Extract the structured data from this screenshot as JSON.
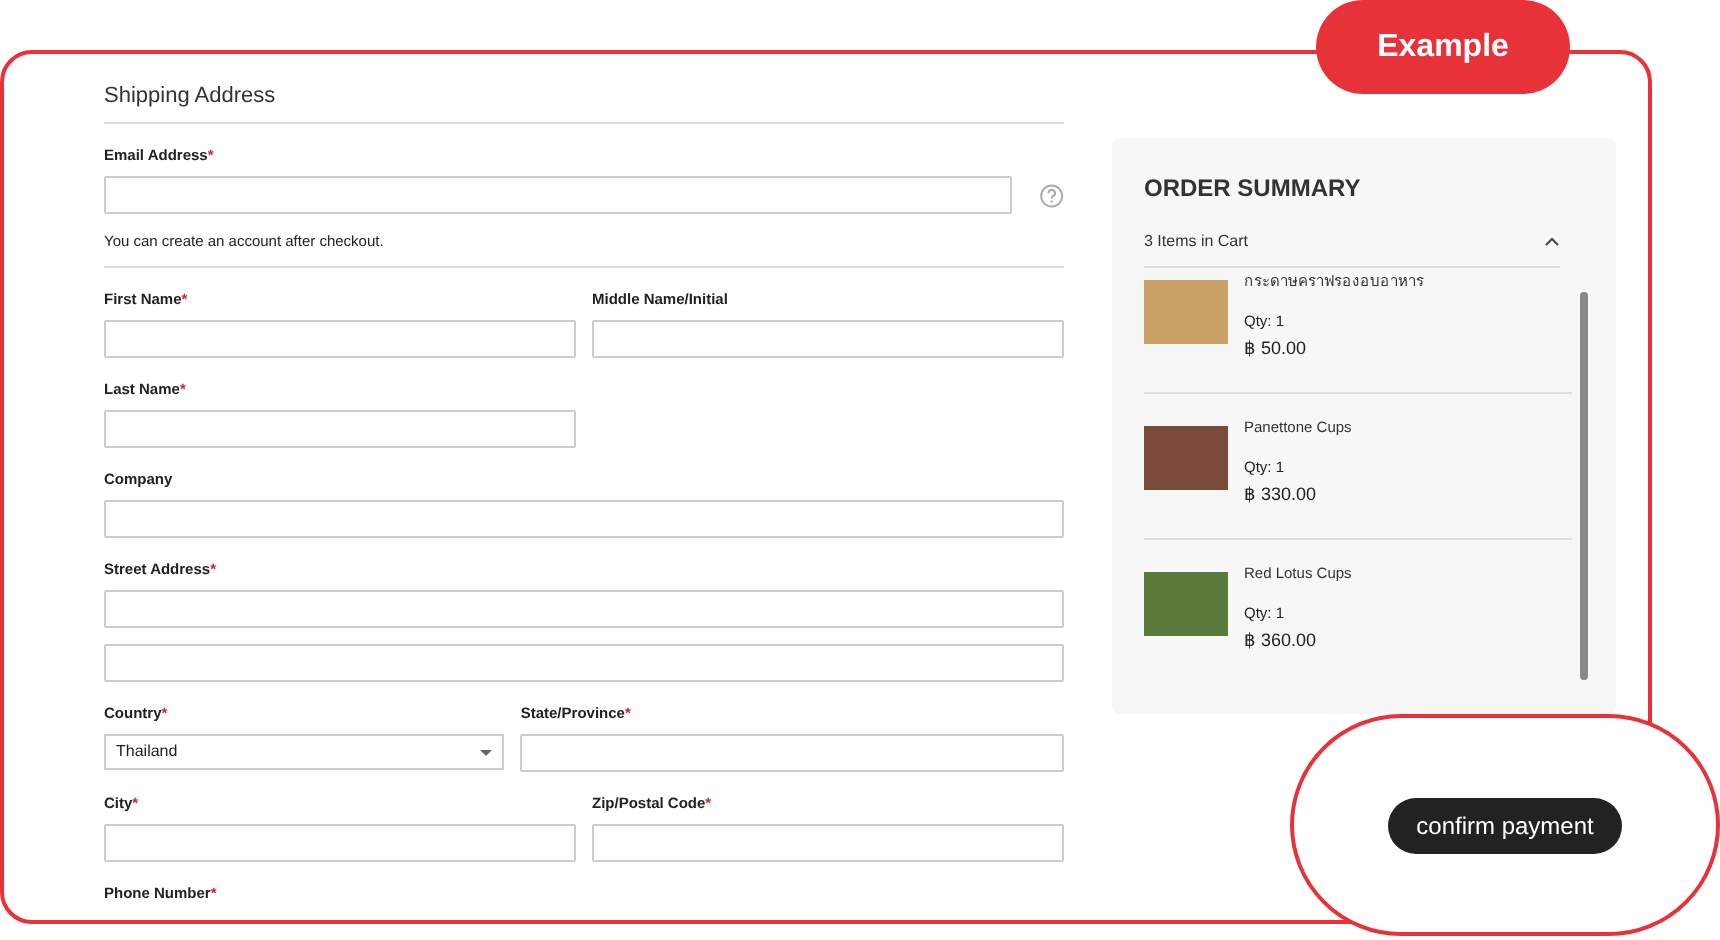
{
  "badge": "Example",
  "form": {
    "title": "Shipping Address",
    "email": {
      "label": "Email Address",
      "mark": "*",
      "note": "You can create an account after checkout."
    },
    "rows": [
      {
        "kind": "full",
        "fields": [
          {
            "label": "First Name",
            "mark": "*",
            "kind": "text"
          },
          {
            "label": "Middle Name/Initial",
            "kind": "text"
          }
        ]
      },
      {
        "kind": "half",
        "fields": [
          {
            "label": "Last Name",
            "mark": "*",
            "kind": "text"
          }
        ]
      },
      {
        "kind": "full",
        "fields": [
          {
            "label": "Company",
            "kind": "text"
          }
        ]
      },
      {
        "kind": "full",
        "fields": [
          {
            "label": "Street Address",
            "mark": "*",
            "kind": "double"
          }
        ]
      },
      {
        "kind": "full",
        "fields": [
          {
            "label": "Country",
            "mark": "*",
            "kind": "select",
            "value": "Thailand"
          },
          {
            "label": "State/Province",
            "mark": "*",
            "kind": "text"
          }
        ]
      },
      {
        "kind": "full",
        "fields": [
          {
            "label": "City",
            "mark": "*",
            "kind": "text"
          },
          {
            "label": "Zip/Postal Code",
            "mark": "*",
            "kind": "text"
          }
        ]
      },
      {
        "kind": "full",
        "fields": [
          {
            "label": "Phone Number",
            "mark": "*",
            "kind": "cut"
          }
        ]
      }
    ]
  },
  "summary": {
    "title": "ORDER SUMMARY",
    "count": "3 Items in Cart",
    "expanded": true,
    "items": [
      {
        "name": "กระดาษคราฟรองอบอาหาร",
        "qty": "Qty: 1",
        "price": "฿ 50.00",
        "color": "#c9a366"
      },
      {
        "name": "Panettone Cups",
        "qty": "Qty: 1",
        "price": "฿ 330.00",
        "color": "#7a4a3a"
      },
      {
        "name": "Red Lotus Cups",
        "qty": "Qty: 1",
        "price": "฿ 360.00",
        "color": "#5a7a3a"
      }
    ]
  },
  "button": "confirm payment"
}
